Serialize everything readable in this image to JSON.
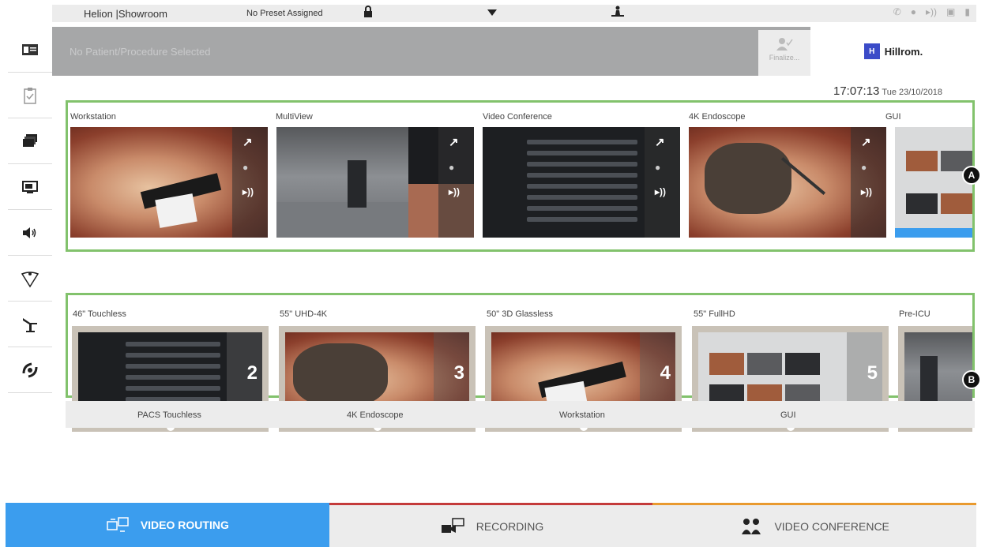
{
  "topbar": {
    "brand": "Helion |Showroom",
    "preset": "No Preset Assigned"
  },
  "patient": {
    "text": "No Patient/Procedure Selected",
    "finalize_label": "Finalize...",
    "logo_mark": "H",
    "logo_text": "Hillrom."
  },
  "clock": {
    "time": "17:07:13",
    "date": "Tue 23/10/2018"
  },
  "sources": {
    "items": [
      {
        "label": "Workstation"
      },
      {
        "label": "MultiView"
      },
      {
        "label": "Video Conference"
      },
      {
        "label": "4K Endoscope"
      },
      {
        "label": "GUI"
      }
    ]
  },
  "destinations": {
    "items": [
      {
        "label": "46\" Touchless",
        "number": "2"
      },
      {
        "label": "55\" UHD-4K",
        "number": "3"
      },
      {
        "label": "50\" 3D Glassless",
        "number": "4"
      },
      {
        "label": "55\" FullHD",
        "number": "5"
      },
      {
        "label": "Pre-ICU",
        "number": ""
      }
    ]
  },
  "assigned_sources": [
    "PACS Touchless",
    "4K Endoscope",
    "Workstation",
    "GUI"
  ],
  "callouts": {
    "a": "A",
    "b": "B"
  },
  "tabs": [
    {
      "label": "VIDEO ROUTING",
      "active": true
    },
    {
      "label": "RECORDING",
      "active": false
    },
    {
      "label": "VIDEO CONFERENCE",
      "active": false
    }
  ],
  "colors": {
    "accent": "#3b9dee",
    "group_border": "#82c26c",
    "recording": "#c43b3b",
    "conference": "#e99a2f"
  }
}
